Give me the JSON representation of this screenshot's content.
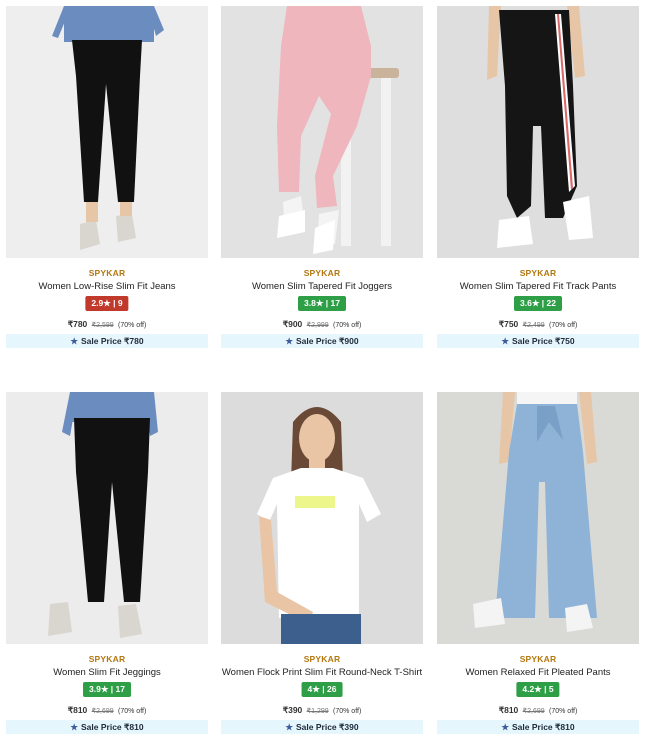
{
  "products": [
    {
      "brand": "SPYKAR",
      "name": "Women Low-Rise Slim Fit Jeans",
      "rating": "2.9★ | 9",
      "rating_color": "#c0392b",
      "price": "₹780",
      "mrp": "₹2,599",
      "discount": "(70% off)",
      "sale_label": "Sale Price ₹780",
      "image_bg": "#eeeeee",
      "garment_color": "#111111",
      "top_color": "#6b8cbf"
    },
    {
      "brand": "SPYKAR",
      "name": "Women Slim Tapered Fit Joggers",
      "rating": "3.8★ | 17",
      "rating_color": "#2e9f47",
      "price": "₹900",
      "mrp": "₹2,999",
      "discount": "(70% off)",
      "sale_label": "Sale Price ₹900",
      "image_bg": "#e2e2e2",
      "garment_color": "#efb6bd",
      "top_color": "#f5f5f5"
    },
    {
      "brand": "SPYKAR",
      "name": "Women Slim Tapered Fit Track Pants",
      "rating": "3.6★ | 22",
      "rating_color": "#2e9f47",
      "price": "₹750",
      "mrp": "₹2,499",
      "discount": "(70% off)",
      "sale_label": "Sale Price ₹750",
      "image_bg": "#dedede",
      "garment_color": "#151515",
      "top_color": "#f5f5f5"
    },
    {
      "brand": "SPYKAR",
      "name": "Women Slim Fit Jeggings",
      "rating": "3.9★ | 17",
      "rating_color": "#2e9f47",
      "price": "₹810",
      "mrp": "₹2,699",
      "discount": "(70% off)",
      "sale_label": "Sale Price ₹810",
      "image_bg": "#ececec",
      "garment_color": "#111111",
      "top_color": "#6b8cbf"
    },
    {
      "brand": "SPYKAR",
      "name": "Women Flock Print Slim Fit Round-Neck T-Shirt",
      "rating": "4★ | 26",
      "rating_color": "#2e9f47",
      "price": "₹390",
      "mrp": "₹1,299",
      "discount": "(70% off)",
      "sale_label": "Sale Price ₹390",
      "image_bg": "#dcdcdc",
      "garment_color": "#ffffff",
      "top_color": "#ffffff"
    },
    {
      "brand": "SPYKAR",
      "name": "Women Relaxed Fit Pleated Pants",
      "rating": "4.2★ | 5",
      "rating_color": "#2e9f47",
      "price": "₹810",
      "mrp": "₹2,699",
      "discount": "(70% off)",
      "sale_label": "Sale Price ₹810",
      "image_bg": "#d9d9d6",
      "garment_color": "#8fb3d6",
      "top_color": "#f5f5f5"
    }
  ]
}
